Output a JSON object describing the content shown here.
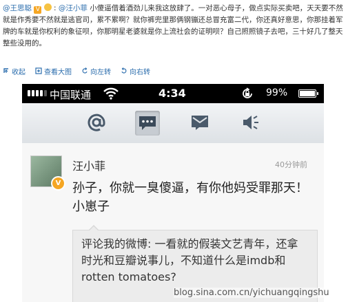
{
  "post": {
    "author": "@王思聪",
    "separator": ":",
    "reply_to": "@汪小菲",
    "body": "小傻逼借着酒劲儿来我这放肆了。一对恶心母子，做点实际买卖吧，天天要不然就是作秀要不然就是逃官司，累不累啊？就你裤兜里那俩钢镚还总冒充富二代，你还真好意思，你那挂着军牌的车就是你权利的象征呗，你那明星老婆就是你上流社会的证明呗？自己照照镜子去吧，三十好几了整天整些没用的。"
  },
  "actions": {
    "collapse": "收起",
    "view_large": "查看大图",
    "rotate_left": "向左转",
    "rotate_right": "向右转"
  },
  "phone": {
    "carrier": "中国联通",
    "time": "4:34",
    "battery": "99%"
  },
  "toolbar": {
    "tabs": [
      "at-mentions",
      "comments",
      "direct-messages",
      "notifications"
    ],
    "active": "comments"
  },
  "comment": {
    "username": "汪小菲",
    "time": "40分钟前",
    "text": "孙子，你就一臭傻逼，有你他妈受罪那天！小崽子",
    "quote": "评论我的微博: 一看就的假装文艺青年，还拿时光和豆瓣说事儿，不知道什么是imdb和rotten tomatoes?"
  },
  "watermark": "blog.sina.com.cn/yichuangqingshu",
  "colors": {
    "link": "#2b6dad",
    "badge": "#f5a623"
  }
}
